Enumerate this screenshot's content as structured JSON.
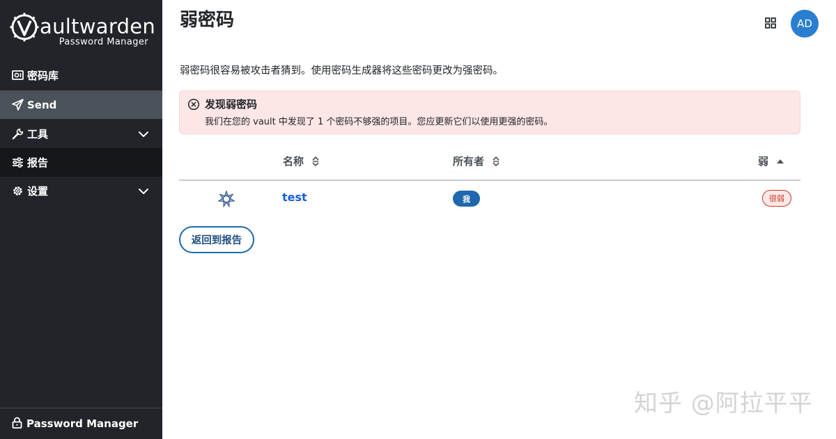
{
  "brand": {
    "name": "aultwarden",
    "subtitle": "Password Manager"
  },
  "sidebar": {
    "items": [
      {
        "label": "密码库",
        "icon": "vault-icon"
      },
      {
        "label": "Send",
        "icon": "send-icon"
      },
      {
        "label": "工具",
        "icon": "wrench-icon",
        "expandable": true
      },
      {
        "label": "报告",
        "icon": "sliders-icon",
        "active": true
      },
      {
        "label": "设置",
        "icon": "gear-icon",
        "expandable": true
      }
    ],
    "footer": {
      "label": "Password Manager",
      "icon": "lock-icon"
    }
  },
  "header": {
    "title": "弱密码",
    "avatar_initials": "AD"
  },
  "description": "弱密码很容易被攻击者猜到。使用密码生成器将这些密码更改为强密码。",
  "alert": {
    "title": "发现弱密码",
    "body": "我们在您的 vault 中发现了 1 个密码不够强的项目。您应更新它们以使用更强的密码。"
  },
  "table": {
    "columns": [
      "名称",
      "所有者",
      "弱"
    ],
    "rows": [
      {
        "name": "test",
        "owner": "我",
        "strength": "很弱"
      }
    ]
  },
  "actions": {
    "back_label": "返回到报告"
  },
  "watermark": "知乎 @阿拉平平",
  "colors": {
    "sidebar_bg": "#212529",
    "accent": "#175ddc",
    "danger": "#c83522",
    "alert_bg": "#fde6e6",
    "avatar_bg": "#2a7ecf"
  }
}
